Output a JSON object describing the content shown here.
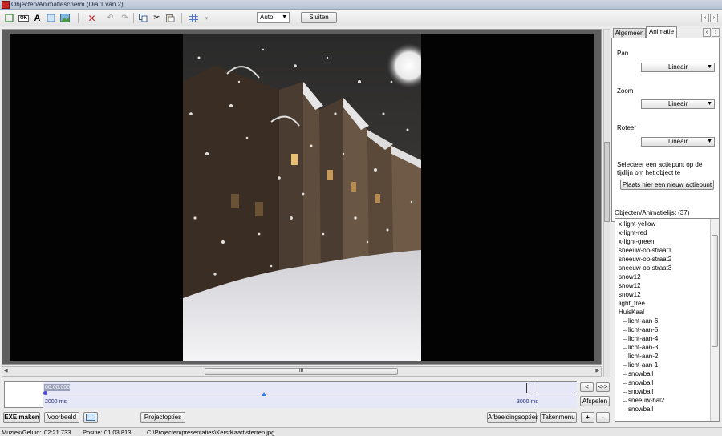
{
  "window": {
    "title": "Objecten/Animatiescherm   (Dia 1 van 2)"
  },
  "toolbar": {
    "icons": [
      "rectangle-icon",
      "button-icon",
      "text-icon",
      "frame-icon",
      "image-icon",
      "delete-icon",
      "undo-icon",
      "redo-icon",
      "copy-icon",
      "cut-icon",
      "paste-icon",
      "grid-icon"
    ],
    "button_label_icon_text": "OK",
    "text_icon_glyph": "A",
    "zoom_select": "Auto",
    "close_button": "Sluiten",
    "nav_prev": "‹",
    "nav_next": "›"
  },
  "right_panel": {
    "tabs": [
      "Algemeen",
      "Animatie"
    ],
    "active_tab": "Animatie",
    "pan_label": "Pan",
    "pan_value": "Lineair",
    "zoom_label": "Zoom",
    "zoom_value": "Lineair",
    "rotate_label": "Roteer",
    "rotate_value": "Lineair",
    "hint": "Selecteer een actiepunt op de tijdlijn om het object te",
    "add_keyframe_button": "Plaats hier een nieuw actiepunt",
    "object_list_title": "Objecten/Animatielijst (37)",
    "object_list": [
      "x-light-yellow",
      "x-light-red",
      "x-light-green",
      "sneeuw-op-straat1",
      "sneeuw-op-straat2",
      "sneeuw-op-straat3",
      "snow12",
      "snow12",
      "snow12",
      "light_tree",
      "HuisKaal",
      "licht-aan-6",
      "licht-aan-5",
      "licht-aan-4",
      "licht-aan-3",
      "licht-aan-2",
      "licht-aan-1",
      "snowball",
      "snowball",
      "snowball",
      "sneeuw-bal2",
      "snowball"
    ]
  },
  "timeline": {
    "time_field": "00:00.000",
    "start_ms": "2000 ms",
    "end_ms": "3000 ms",
    "prev_button": "<",
    "next_button": "<->",
    "play_button": "Afspelen",
    "scroll_grip": "III"
  },
  "bottom": {
    "exe_button": "EXE maken",
    "preview_button": "Voorbeeld",
    "project_options_button": "Projectopties",
    "image_options_button": "Afbeeldingsopties",
    "task_menu_button": "Takenmenu",
    "plus_button": "+",
    "minus_button": "-"
  },
  "status": {
    "music_label": "Muziek/Geluid:",
    "music_time": "02:21.733",
    "position_label": "Positie:",
    "position_time": "01:03.813",
    "file_path": "C:\\Projecten\\presentaties\\KerstKaart\\sterren.jpg"
  },
  "colors": {
    "accent_red": "#c62828",
    "timeline_blue": "#1f2a78",
    "timeline_bg": "#e6e8f7"
  }
}
